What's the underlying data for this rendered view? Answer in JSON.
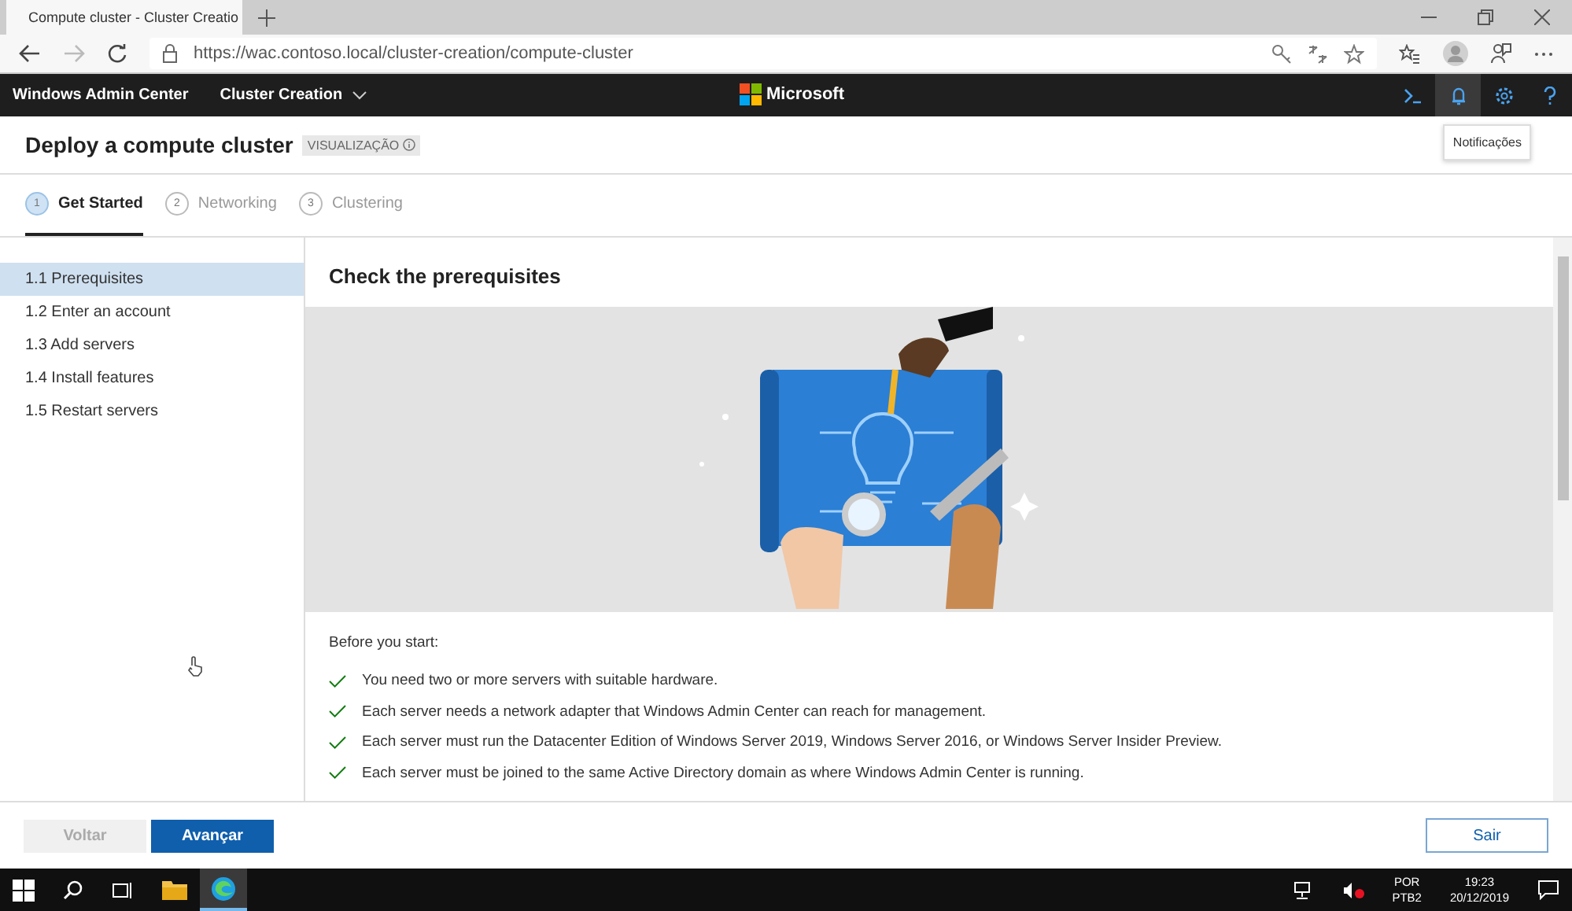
{
  "browser": {
    "tab_title": "Compute cluster - Cluster Creatio",
    "url": "https://wac.contoso.local/cluster-creation/compute-cluster"
  },
  "header": {
    "app_name": "Windows Admin Center",
    "context": "Cluster Creation",
    "brand": "Microsoft",
    "tooltip": "Notificações"
  },
  "page": {
    "title": "Deploy a compute cluster",
    "badge": "VISUALIZAÇÃO"
  },
  "steps": [
    {
      "number": "1",
      "label": "Get Started",
      "selected": true
    },
    {
      "number": "2",
      "label": "Networking",
      "selected": false
    },
    {
      "number": "3",
      "label": "Clustering",
      "selected": false
    }
  ],
  "sidebar": {
    "items": [
      {
        "label": "1.1  Prerequisites",
        "selected": true
      },
      {
        "label": "1.2  Enter an account",
        "selected": false
      },
      {
        "label": "1.3  Add servers",
        "selected": false
      },
      {
        "label": "1.4  Install features",
        "selected": false
      },
      {
        "label": "1.5  Restart servers",
        "selected": false
      }
    ]
  },
  "content": {
    "heading": "Check the prerequisites",
    "intro": "Before you start:",
    "checklist": [
      "You need two or more servers with suitable hardware.",
      "Each server needs a network adapter that Windows Admin Center can reach for management.",
      "Each server must run the Datacenter Edition of Windows Server 2019, Windows Server 2016, or Windows Server Insider Preview.",
      "Each server must be joined to the same Active Directory domain as where Windows Admin Center is running."
    ]
  },
  "footer": {
    "buttons": [
      {
        "label": "Voltar",
        "kind": "secondary",
        "disabled": true
      },
      {
        "label": "Avançar",
        "kind": "primary",
        "disabled": false
      }
    ],
    "exit": "Sair"
  },
  "taskbar": {
    "language": "POR",
    "layout": "PTB2",
    "time": "19:23",
    "date": "20/12/2019"
  }
}
